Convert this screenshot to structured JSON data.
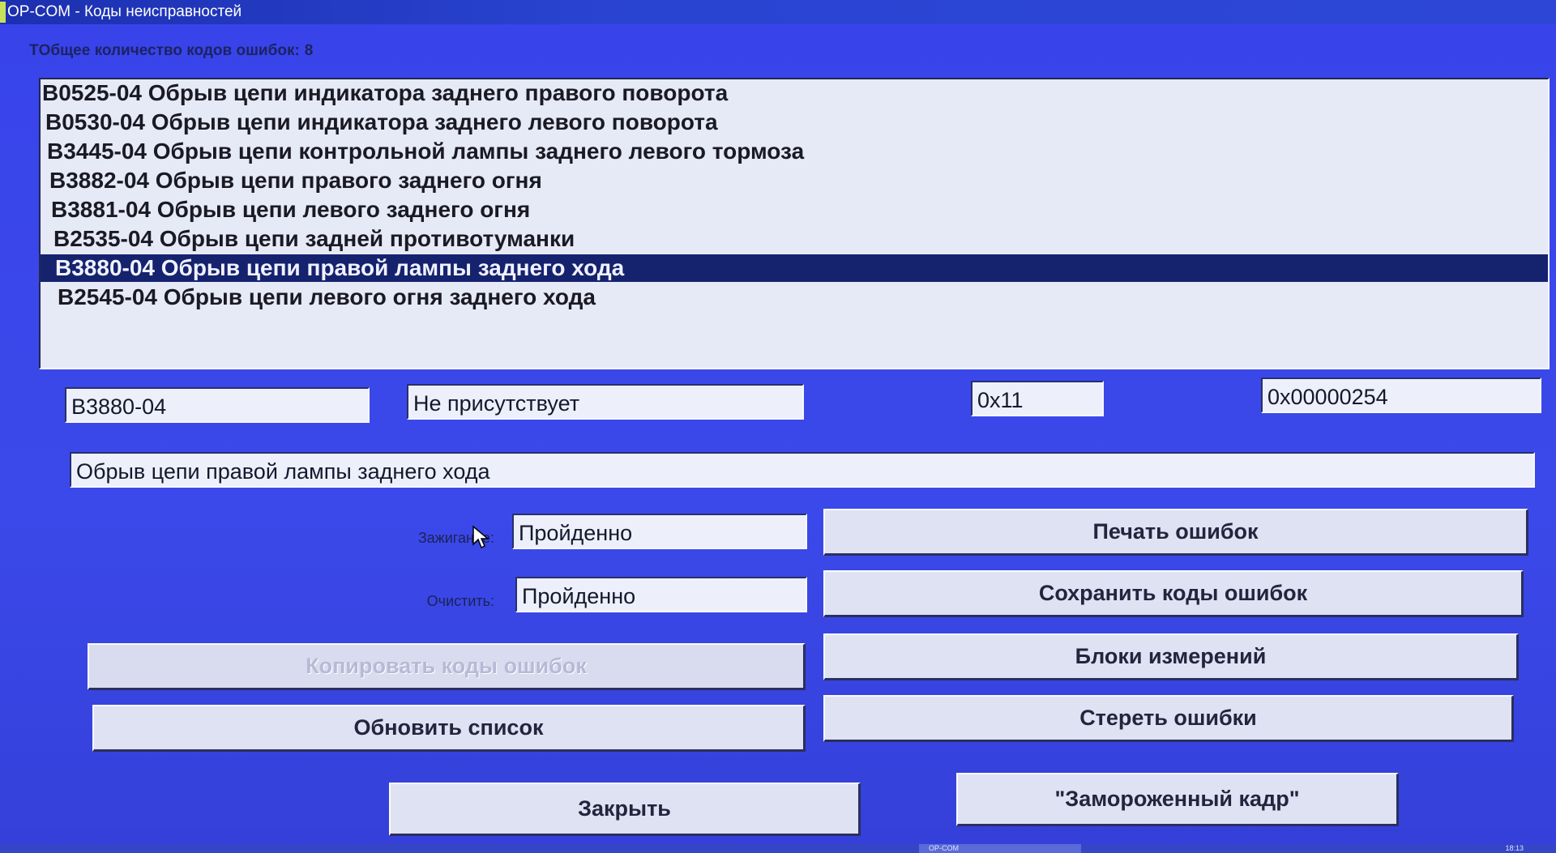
{
  "window": {
    "title": "OP-COM - Коды неисправностей"
  },
  "summary": {
    "total_label": "TОбщее количество кодов ошибок:",
    "total_value": "8"
  },
  "dtc_list": [
    "B0525-04 Обрыв цепи индикатора заднего правого поворота",
    "B0530-04 Обрыв цепи индикатора заднего левого поворота",
    "B3445-04 Обрыв цепи контрольной лампы заднего левого тормоза",
    "B3882-04 Обрыв цепи правого заднего огня",
    "B3881-04 Обрыв цепи левого заднего огня",
    "B2535-04 Обрыв цепи задней противотуманки",
    "B3880-04 Обрыв цепи правой лампы заднего хода",
    "B2545-04 Обрыв цепи левого огня заднего хода"
  ],
  "selected_index": 6,
  "details": {
    "code": "B3880-04",
    "status": "Не присутствует",
    "hex1": "0x11",
    "hex2": "0x00000254",
    "description": "Обрыв цепи правой лампы заднего хода",
    "ignition_label": "Зажигание:",
    "ignition_value": "Пройденно",
    "clear_label": "Очистить:",
    "clear_value": "Пройденно"
  },
  "buttons": {
    "print": "Печать ошибок",
    "save": "Сохранить коды ошибок",
    "copy": "Копировать коды ошибок",
    "measure": "Блоки измерений",
    "refresh": "Обновить список",
    "erase": "Стереть ошибки",
    "close": "Закрыть",
    "freeze": "\"Замороженный кадр\""
  },
  "taskbar": {
    "task": "OP-COM",
    "clock": "18:13"
  },
  "colors": {
    "window_bg": "#3a46e6",
    "selected_row": "#15226e",
    "field_bg": "#edf0fa"
  }
}
